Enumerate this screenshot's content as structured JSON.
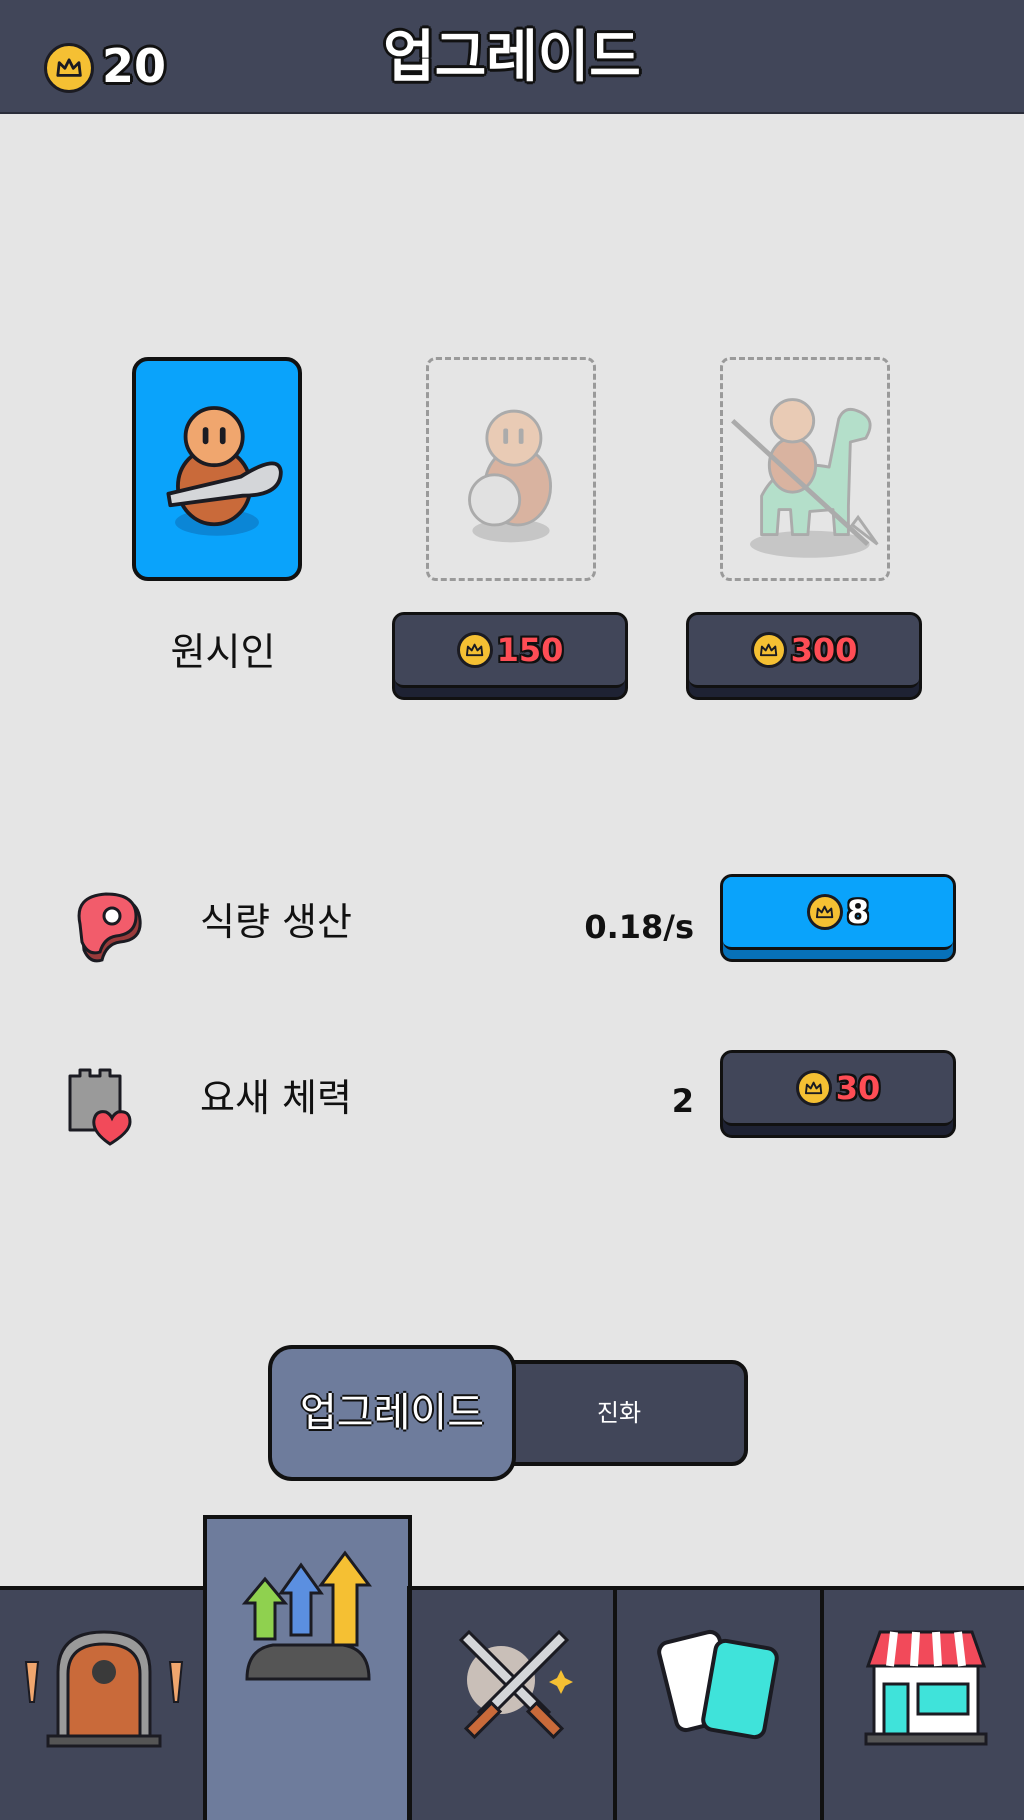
{
  "header": {
    "coin_icon": "crown-coin-icon",
    "coin_count": "20",
    "title": "업그레이드"
  },
  "units": [
    {
      "name": "원시인",
      "state": "unlocked",
      "icon": "caveman-club-icon"
    },
    {
      "price": "150",
      "state": "locked",
      "icon": "caveman-shield-icon"
    },
    {
      "price": "300",
      "state": "locked",
      "icon": "dino-rider-spear-icon"
    }
  ],
  "stats": [
    {
      "icon": "meat-icon",
      "label": "식량 생산",
      "value": "0.18/s",
      "price": "8",
      "button_style": "blue"
    },
    {
      "icon": "castle-heart-icon",
      "label": "요새 체력",
      "value": "2",
      "price": "30",
      "button_style": "dark"
    }
  ],
  "tabs": [
    {
      "label": "업그레이드",
      "active": true
    },
    {
      "label": "진화",
      "active": false
    }
  ],
  "bottom_nav": [
    {
      "icon": "castle-door-icon",
      "active": false
    },
    {
      "icon": "upgrade-arrows-icon",
      "active": true
    },
    {
      "icon": "crossed-swords-icon",
      "active": false
    },
    {
      "icon": "cards-icon",
      "active": false
    },
    {
      "icon": "shop-icon",
      "active": false
    }
  ],
  "colors": {
    "header_bg": "#414659",
    "page_bg": "#e5e5e5",
    "accent_blue": "#0aa3fb",
    "price_red": "#ff4d55",
    "coin_gold": "#f5c033",
    "active_tab": "#6e7c9c"
  }
}
